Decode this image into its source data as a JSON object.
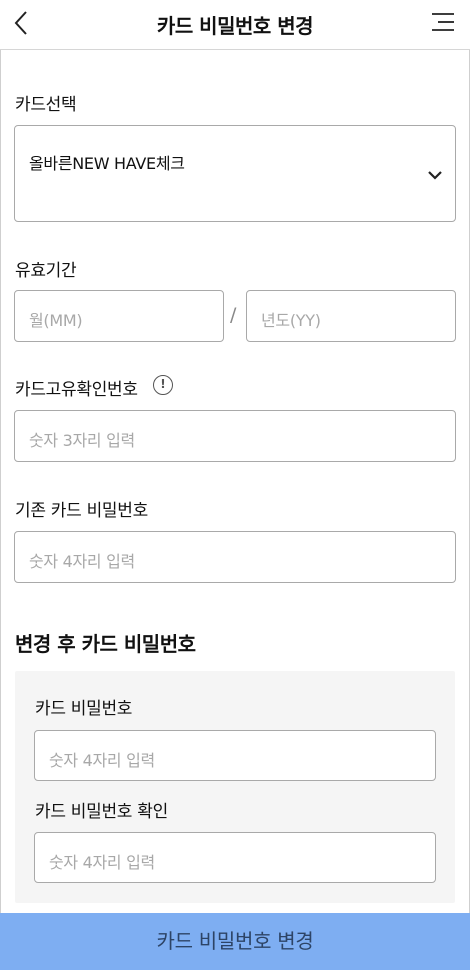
{
  "header": {
    "title": "카드 비밀번호 변경",
    "back_icon": "chevron-left-icon",
    "menu_icon": "menu-icon"
  },
  "card_select": {
    "label": "카드선택",
    "value": "올바른NEW HAVE체크",
    "icon": "chevron-down-icon"
  },
  "expiry": {
    "label": "유효기간",
    "month_placeholder": "월(MM)",
    "separator": "/",
    "year_placeholder": "년도(YY)"
  },
  "card_id": {
    "label": "카드고유확인번호",
    "info_glyph": "!",
    "placeholder": "숫자 3자리 입력"
  },
  "current_pin": {
    "label": "기존 카드 비밀번호",
    "placeholder": "숫자 4자리 입력"
  },
  "new_pin_section": {
    "title": "변경 후 카드 비밀번호",
    "pin_label": "카드 비밀번호",
    "pin_placeholder": "숫자 4자리 입력",
    "confirm_label": "카드 비밀번호 확인",
    "confirm_placeholder": "숫자 4자리 입력"
  },
  "submit": {
    "label": "카드 비밀번호 변경",
    "color": "#7eaef2"
  }
}
